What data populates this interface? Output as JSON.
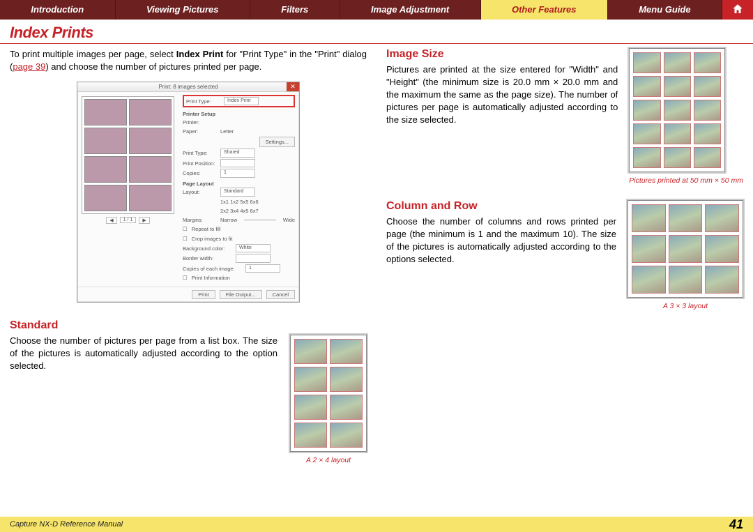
{
  "nav": {
    "tabs": [
      {
        "label": "Introduction"
      },
      {
        "label": "Viewing Pictures"
      },
      {
        "label": "Filters"
      },
      {
        "label": "Image Adjustment"
      },
      {
        "label": "Other Features"
      },
      {
        "label": "Menu Guide"
      }
    ],
    "active_index": 4
  },
  "page_title": "Index Prints",
  "intro": {
    "pre": "To print multiple images per page, select ",
    "bold": "Index Print",
    "mid": " for \"Print Type\" in the \"Print\" dialog (",
    "link": "page 39",
    "post": ") and choose the number of pictures printed per page."
  },
  "print_dialog": {
    "title": "Print: 8 images selected",
    "close": "✕",
    "print_type_label": "Print Type:",
    "print_type_value": "Index Print",
    "sections": {
      "printer_setup": "Printer Setup",
      "printer": "Printer:",
      "paper": "Paper:",
      "paper_value": "Letter",
      "settings_btn": "Settings...",
      "print_type": "Print Type:",
      "print_type_value2": "Shared",
      "print_position": "Print Position:",
      "copies": "Copies:",
      "copies_value": "1",
      "page_layout": "Page Layout",
      "layout": "Layout:",
      "layout_value": "Standard",
      "grid_row1": "1x1  1x2  5x5  6x6",
      "grid_row2": "2x2  3x4  4x5  6x7",
      "slider_l": "Narrow",
      "slider_r": "Wide",
      "margins": "Margins:",
      "repeat": "Repeat to fill",
      "crop": "Crop images to fit",
      "bgcolor": "Background color:",
      "bgcolor_value": "White",
      "border": "Border width:",
      "copies2": "Copies of each image:",
      "copies2_value": "1",
      "printinfo": "Print Information"
    },
    "nav_prev": "◀",
    "nav_page": "1 / 1",
    "nav_next": "▶",
    "buttons": {
      "print": "Print",
      "output": "File Output...",
      "cancel": "Cancel"
    }
  },
  "standard": {
    "head": "Standard",
    "text": "Choose the number of pictures per page from a list box. The size of the pictures is automatically adjusted according to the option selected.",
    "caption": "A 2 × 4 layout"
  },
  "image_size": {
    "head": "Image Size",
    "text": "Pictures are printed at the size entered for \"Width\" and \"Height\" (the minimum size is 20.0 mm × 20.0 mm and the maximum the same as the page size). The number of pictures per page is automatically adjusted according to the size selected.",
    "caption": "Pictures printed at 50 mm × 50 mm"
  },
  "column_row": {
    "head": "Column and Row",
    "text": "Choose the number of columns and rows printed per page (the minimum is 1 and the maximum 10). The size of the pictures is automatically adjusted according to the options selected.",
    "caption": "A 3 × 3 layout"
  },
  "footer": {
    "manual": "Capture NX-D Reference Manual",
    "page": "41"
  }
}
